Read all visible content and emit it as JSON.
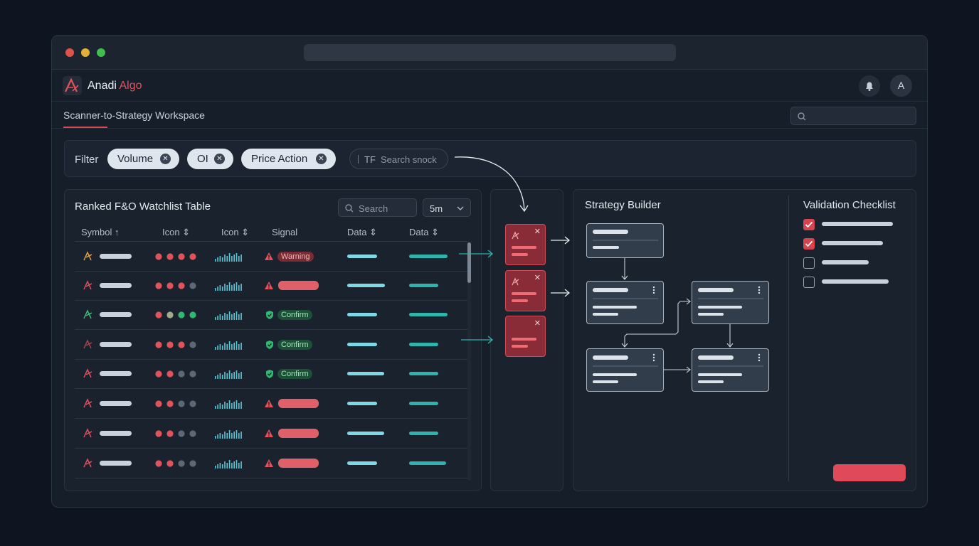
{
  "app": {
    "brand_main": "Anadi",
    "brand_accent": "Algo",
    "avatar_initial": "A",
    "workspace_title": "Scanner-to-Strategy Workspace"
  },
  "filter": {
    "label": "Filter",
    "chips": [
      "Volume",
      "OI",
      "Price Action"
    ],
    "tf_prefix": "TF",
    "tf_placeholder": "Search snock"
  },
  "watchlist": {
    "title": "Ranked F&O Watchlist Table",
    "search_placeholder": "Search",
    "timeframe": "5m",
    "columns": [
      "Symbol",
      "Icon",
      "Icon",
      "Signal",
      "Data",
      "Data"
    ],
    "signals": [
      "Warning",
      "",
      "Confirm",
      "Confirm",
      "Confirm",
      "",
      "",
      ""
    ]
  },
  "builder": {
    "title": "Strategy Builder"
  },
  "checklist": {
    "title": "Validation Checklist",
    "items_checked": [
      true,
      true,
      false,
      false
    ]
  },
  "colors": {
    "accent": "#e0525c",
    "teal": "#2fb3ad",
    "cyan": "#7fd8e4"
  }
}
